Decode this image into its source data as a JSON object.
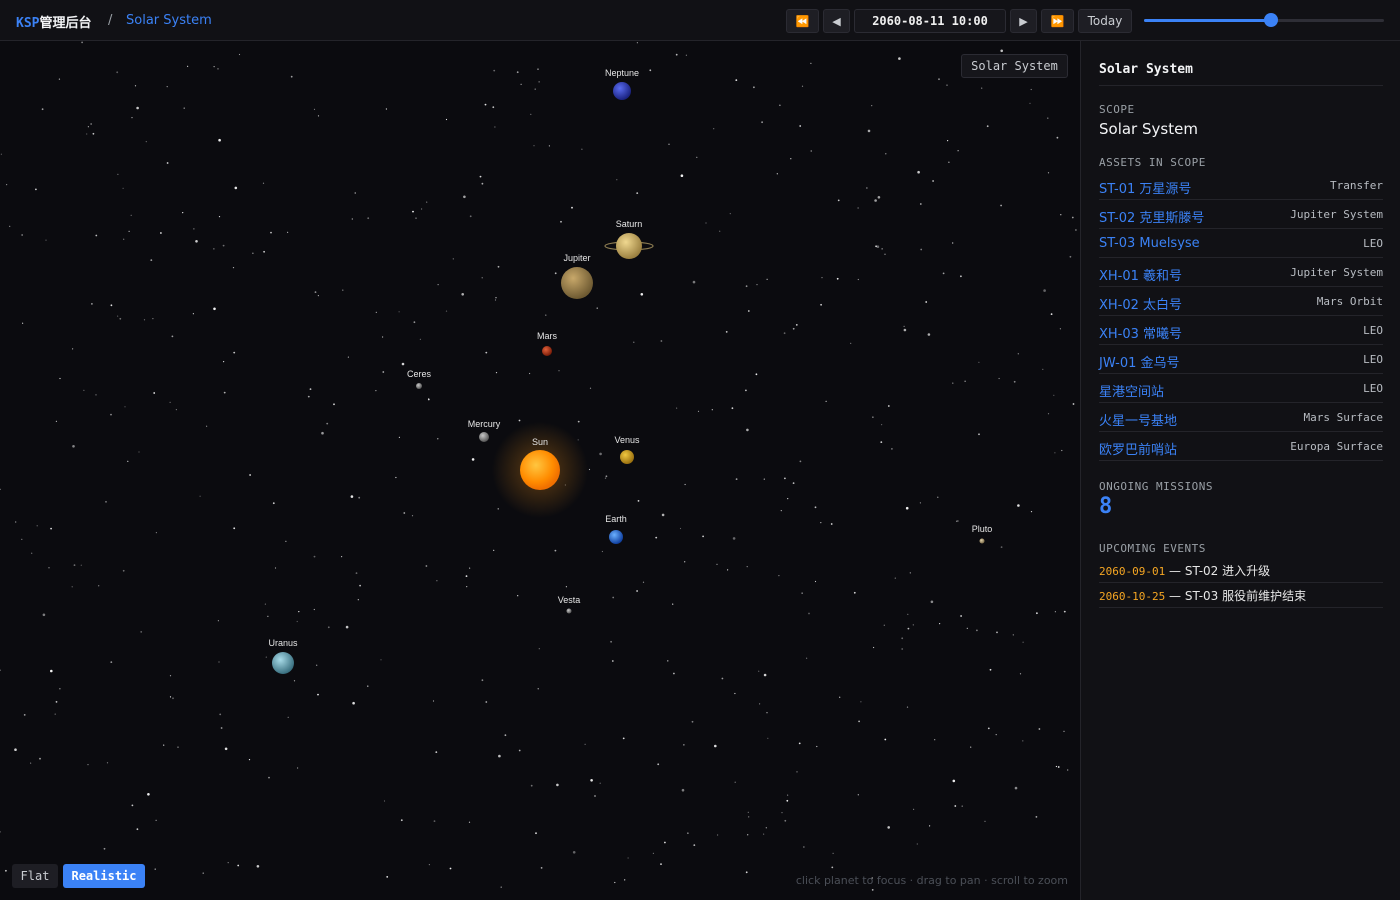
{
  "header": {
    "brand_prefix": "KSP",
    "brand_suffix": "管理后台",
    "breadcrumb_sep": "/",
    "breadcrumb_current": "Solar System"
  },
  "timebar": {
    "rewind_fast_icon": "⏪",
    "step_back_icon": "◀",
    "datetime": "2060-08-11 10:00",
    "step_forward_icon": "▶",
    "forward_fast_icon": "⏩",
    "today_label": "Today",
    "slider_fraction": 0.53
  },
  "viewport": {
    "scope_chip": "Solar System",
    "mode_flat": "Flat",
    "mode_realistic": "Realistic",
    "active_mode": "Realistic",
    "hint": "click planet to focus · drag to pan · scroll to zoom",
    "bodies": [
      {
        "name": "Sun"
      },
      {
        "name": "Mercury"
      },
      {
        "name": "Venus"
      },
      {
        "name": "Earth"
      },
      {
        "name": "Mars"
      },
      {
        "name": "Ceres"
      },
      {
        "name": "Vesta"
      },
      {
        "name": "Jupiter"
      },
      {
        "name": "Saturn"
      },
      {
        "name": "Uranus"
      },
      {
        "name": "Neptune"
      },
      {
        "name": "Pluto"
      }
    ]
  },
  "sidebar": {
    "title": "Solar System",
    "scope_label": "SCOPE",
    "scope_value": "Solar System",
    "assets_label": "ASSETS IN SCOPE",
    "assets": [
      {
        "name": "ST-01 万星源号",
        "location": "Transfer"
      },
      {
        "name": "ST-02 克里斯滕号",
        "location": "Jupiter System"
      },
      {
        "name": "ST-03 Muelsyse",
        "location": "LEO"
      },
      {
        "name": "XH-01 羲和号",
        "location": "Jupiter System"
      },
      {
        "name": "XH-02 太白号",
        "location": "Mars Orbit"
      },
      {
        "name": "XH-03 常曦号",
        "location": "LEO"
      },
      {
        "name": "JW-01 金乌号",
        "location": "LEO"
      },
      {
        "name": "星港空间站",
        "location": "LEO"
      },
      {
        "name": "火星一号基地",
        "location": "Mars Surface"
      },
      {
        "name": "欧罗巴前哨站",
        "location": "Europa Surface"
      }
    ],
    "missions_label": "ONGOING MISSIONS",
    "missions_count": "8",
    "events_label": "UPCOMING EVENTS",
    "events": [
      {
        "date": "2060-09-01",
        "text": " — ST-02 进入升级"
      },
      {
        "date": "2060-10-25",
        "text": " — ST-03 服役前维护结束"
      }
    ]
  },
  "colors": {
    "accent": "#3b82f6",
    "event_date": "#f5a623",
    "background": "#0b0b0f"
  }
}
